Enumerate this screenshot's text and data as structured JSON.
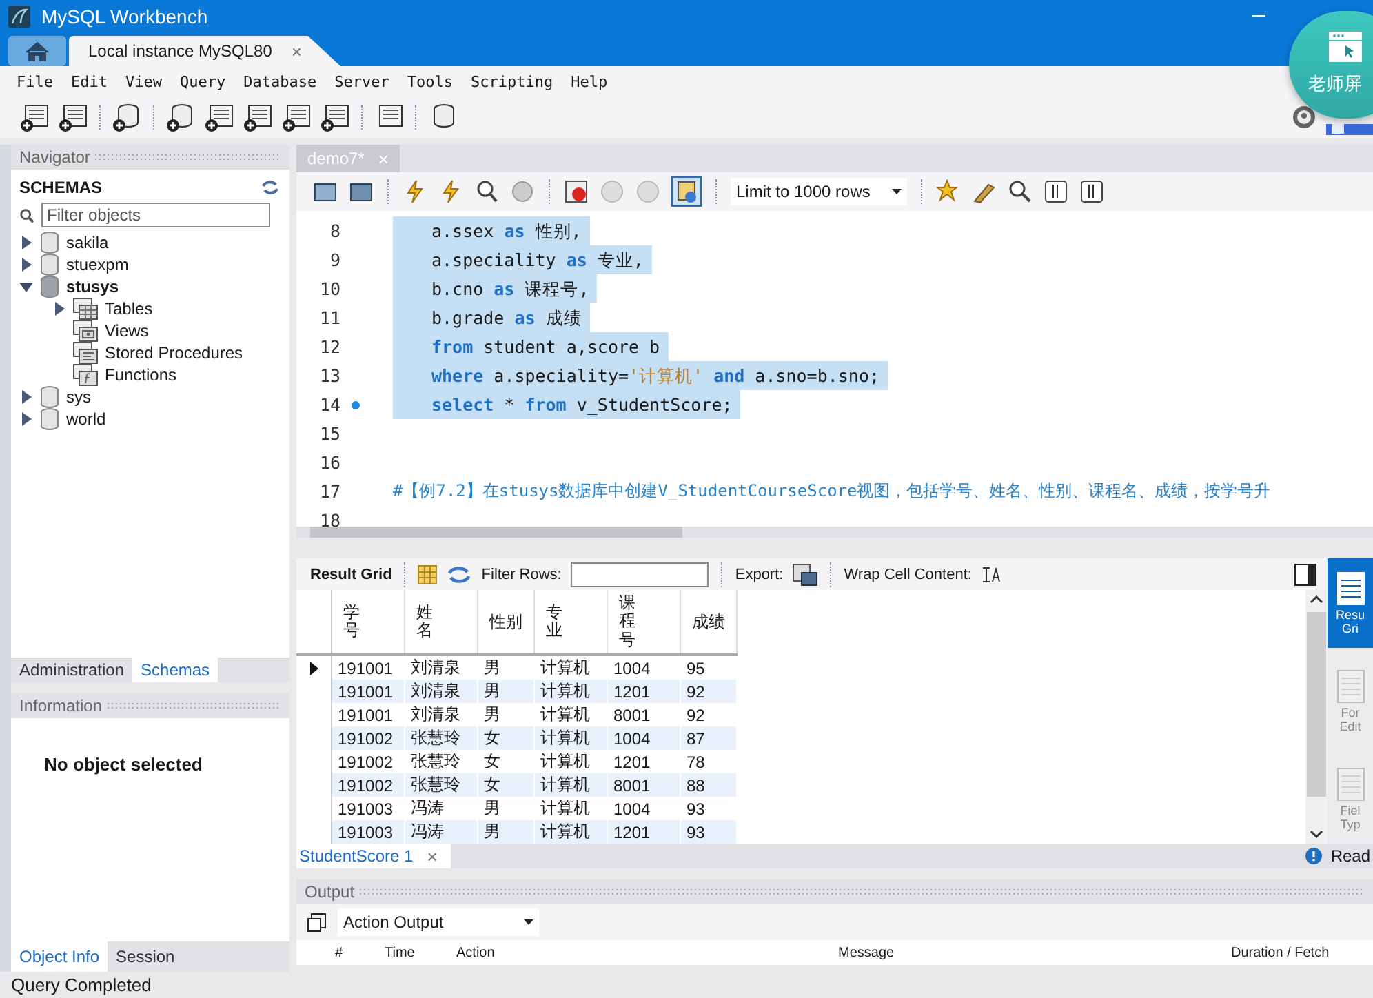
{
  "window": {
    "title": "MySQL Workbench"
  },
  "connection_tabs": [
    {
      "label": "Local instance MySQL80",
      "close": "×"
    }
  ],
  "menu": [
    "File",
    "Edit",
    "View",
    "Query",
    "Database",
    "Server",
    "Tools",
    "Scripting",
    "Help"
  ],
  "overlay": {
    "label": "老师屏"
  },
  "navigator": {
    "title": "Navigator",
    "section": "SCHEMAS",
    "filter": {
      "placeholder": "Filter objects"
    },
    "items": [
      {
        "label": "sakila",
        "kind": "schema",
        "expanded": false,
        "active": false
      },
      {
        "label": "stuexpm",
        "kind": "schema",
        "expanded": false,
        "active": false
      },
      {
        "label": "stusys",
        "kind": "schema",
        "expanded": true,
        "active": true,
        "children": [
          {
            "label": "Tables",
            "kind": "tables",
            "expanded": false
          },
          {
            "label": "Views",
            "kind": "views"
          },
          {
            "label": "Stored Procedures",
            "kind": "procedures"
          },
          {
            "label": "Functions",
            "kind": "functions"
          }
        ]
      },
      {
        "label": "sys",
        "kind": "schema",
        "expanded": false,
        "active": false
      },
      {
        "label": "world",
        "kind": "schema",
        "expanded": false,
        "active": false
      }
    ],
    "tabs": [
      {
        "label": "Administration",
        "selected": false
      },
      {
        "label": "Schemas",
        "selected": true
      }
    ]
  },
  "information": {
    "title": "Information",
    "message": "No object selected",
    "tabs": [
      {
        "label": "Object Info",
        "selected": true
      },
      {
        "label": "Session",
        "selected": false
      }
    ]
  },
  "editor": {
    "tab": {
      "label": "demo7*",
      "close": "×"
    },
    "limit": "Limit to 1000 rows",
    "autocommit_pressed": true,
    "lines": [
      {
        "number": "8",
        "marker": false,
        "selected": true,
        "tokens": [
          {
            "kind": "plain",
            "text": "a.ssex "
          },
          {
            "kind": "kw",
            "text": "as"
          },
          {
            "kind": "plain",
            "text": " 性别,"
          }
        ]
      },
      {
        "number": "9",
        "marker": false,
        "selected": true,
        "tokens": [
          {
            "kind": "plain",
            "text": "a.speciality "
          },
          {
            "kind": "kw",
            "text": "as"
          },
          {
            "kind": "plain",
            "text": " 专业,"
          }
        ]
      },
      {
        "number": "10",
        "marker": false,
        "selected": true,
        "tokens": [
          {
            "kind": "plain",
            "text": "b.cno "
          },
          {
            "kind": "kw",
            "text": "as"
          },
          {
            "kind": "plain",
            "text": " 课程号,"
          }
        ]
      },
      {
        "number": "11",
        "marker": false,
        "selected": true,
        "tokens": [
          {
            "kind": "plain",
            "text": "b.grade "
          },
          {
            "kind": "kw",
            "text": "as"
          },
          {
            "kind": "plain",
            "text": " 成绩"
          }
        ]
      },
      {
        "number": "12",
        "marker": false,
        "selected": true,
        "tokens": [
          {
            "kind": "kw",
            "text": "from"
          },
          {
            "kind": "plain",
            "text": " student a,score b"
          }
        ]
      },
      {
        "number": "13",
        "marker": false,
        "selected": true,
        "tokens": [
          {
            "kind": "kw",
            "text": "where"
          },
          {
            "kind": "plain",
            "text": " a.speciality="
          },
          {
            "kind": "str",
            "text": "'计算机' "
          },
          {
            "kind": "kw",
            "text": "and"
          },
          {
            "kind": "plain",
            "text": " a.sno=b.sno;"
          }
        ]
      },
      {
        "number": "14",
        "marker": true,
        "selected": true,
        "tokens": [
          {
            "kind": "kw",
            "text": "select"
          },
          {
            "kind": "plain",
            "text": " * "
          },
          {
            "kind": "kw",
            "text": "from"
          },
          {
            "kind": "plain",
            "text": " v_StudentScore;"
          }
        ]
      },
      {
        "number": "15",
        "marker": false
      },
      {
        "number": "16",
        "marker": false
      },
      {
        "number": "17",
        "marker": false,
        "selected": false,
        "outdent": true,
        "tokens": [
          {
            "kind": "comment",
            "text": "#【例7.2】在stusys数据库中创建V_StudentCourseScore视图，包括学号、姓名、性别、课程名、成绩，按学号升"
          }
        ]
      },
      {
        "number": "18",
        "marker": false
      }
    ]
  },
  "result": {
    "toolbar": {
      "label": "Result Grid",
      "filter_label": "Filter Rows:",
      "export_label": "Export:",
      "wrap_label": "Wrap Cell Content:"
    },
    "columns": [
      {
        "label": "学号",
        "stacked": true
      },
      {
        "label": "姓名",
        "stacked": true
      },
      {
        "label": "性别",
        "stacked": false
      },
      {
        "label": "专业",
        "stacked": true
      },
      {
        "label": "课程号",
        "stacked": true
      },
      {
        "label": "成绩",
        "stacked": false
      }
    ],
    "rows": [
      {
        "current": true,
        "cells": [
          "191001",
          "刘清泉",
          "男",
          "计算机",
          "1004",
          "95"
        ]
      },
      {
        "current": false,
        "cells": [
          "191001",
          "刘清泉",
          "男",
          "计算机",
          "1201",
          "92"
        ]
      },
      {
        "current": false,
        "cells": [
          "191001",
          "刘清泉",
          "男",
          "计算机",
          "8001",
          "92"
        ]
      },
      {
        "current": false,
        "cells": [
          "191002",
          "张慧玲",
          "女",
          "计算机",
          "1004",
          "87"
        ]
      },
      {
        "current": false,
        "cells": [
          "191002",
          "张慧玲",
          "女",
          "计算机",
          "1201",
          "78"
        ]
      },
      {
        "current": false,
        "cells": [
          "191002",
          "张慧玲",
          "女",
          "计算机",
          "8001",
          "88"
        ]
      },
      {
        "current": false,
        "cells": [
          "191003",
          "冯涛",
          "男",
          "计算机",
          "1004",
          "93"
        ]
      },
      {
        "current": false,
        "cells": [
          "191003",
          "冯涛",
          "男",
          "计算机",
          "1201",
          "93"
        ]
      }
    ],
    "side_panel": [
      {
        "label": "Resu Gri",
        "selected": true
      },
      {
        "label": "For Edit",
        "selected": false
      },
      {
        "label": "Fiel Typ",
        "selected": false
      }
    ],
    "tabs": [
      {
        "label": "StudentScore 1",
        "close": "×",
        "selected": true
      }
    ],
    "read_only": "Read"
  },
  "output": {
    "title": "Output",
    "mode": "Action Output",
    "columns": [
      "#",
      "Time",
      "Action",
      "Message",
      "Duration / Fetch"
    ]
  },
  "status_bar": "Query Completed"
}
